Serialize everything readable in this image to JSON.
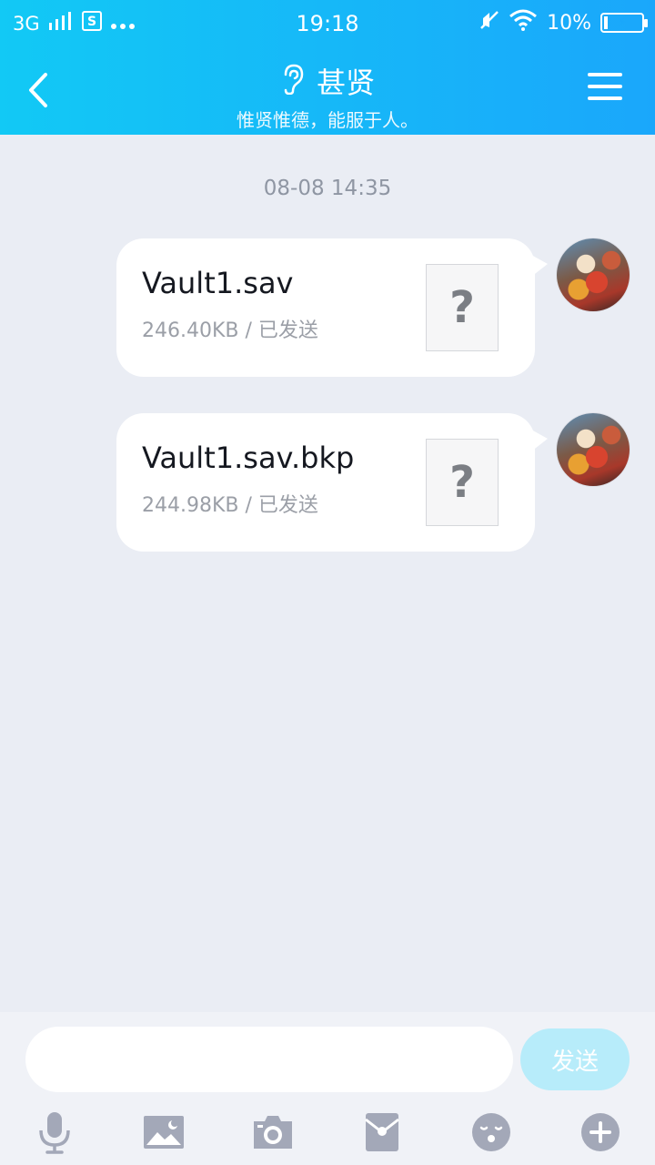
{
  "status_bar": {
    "network": "3G",
    "time": "19:18",
    "battery": "10%",
    "battery_level": 0.1,
    "icons": [
      "signal-icon",
      "sim-icon",
      "more-dots-icon",
      "mute-icon",
      "wifi-icon",
      "battery-icon"
    ]
  },
  "header": {
    "title": "甚贤",
    "subtitle": "惟贤惟德，能服于人。",
    "title_icon": "ear-icon",
    "back_icon": "back-chevron-icon",
    "menu_icon": "menu-icon"
  },
  "chat": {
    "timestamp": "08-08 14:35",
    "messages": [
      {
        "file_name": "Vault1.sav",
        "meta": "246.40KB / 已发送",
        "file_icon": "?"
      },
      {
        "file_name": "Vault1.sav.bkp",
        "meta": "244.98KB / 已发送",
        "file_icon": "?"
      }
    ]
  },
  "input_bar": {
    "placeholder": "",
    "send_label": "发送",
    "tools": [
      "microphone-icon",
      "image-icon",
      "camera-icon",
      "red-packet-icon",
      "emoji-icon",
      "plus-icon"
    ]
  },
  "colors": {
    "header_start": "#12c9f5",
    "header_end": "#1aa7fb",
    "chat_background": "#eaedf4",
    "send_button": "#b7ecfa",
    "toolbar_icon": "#a3a8b8"
  }
}
